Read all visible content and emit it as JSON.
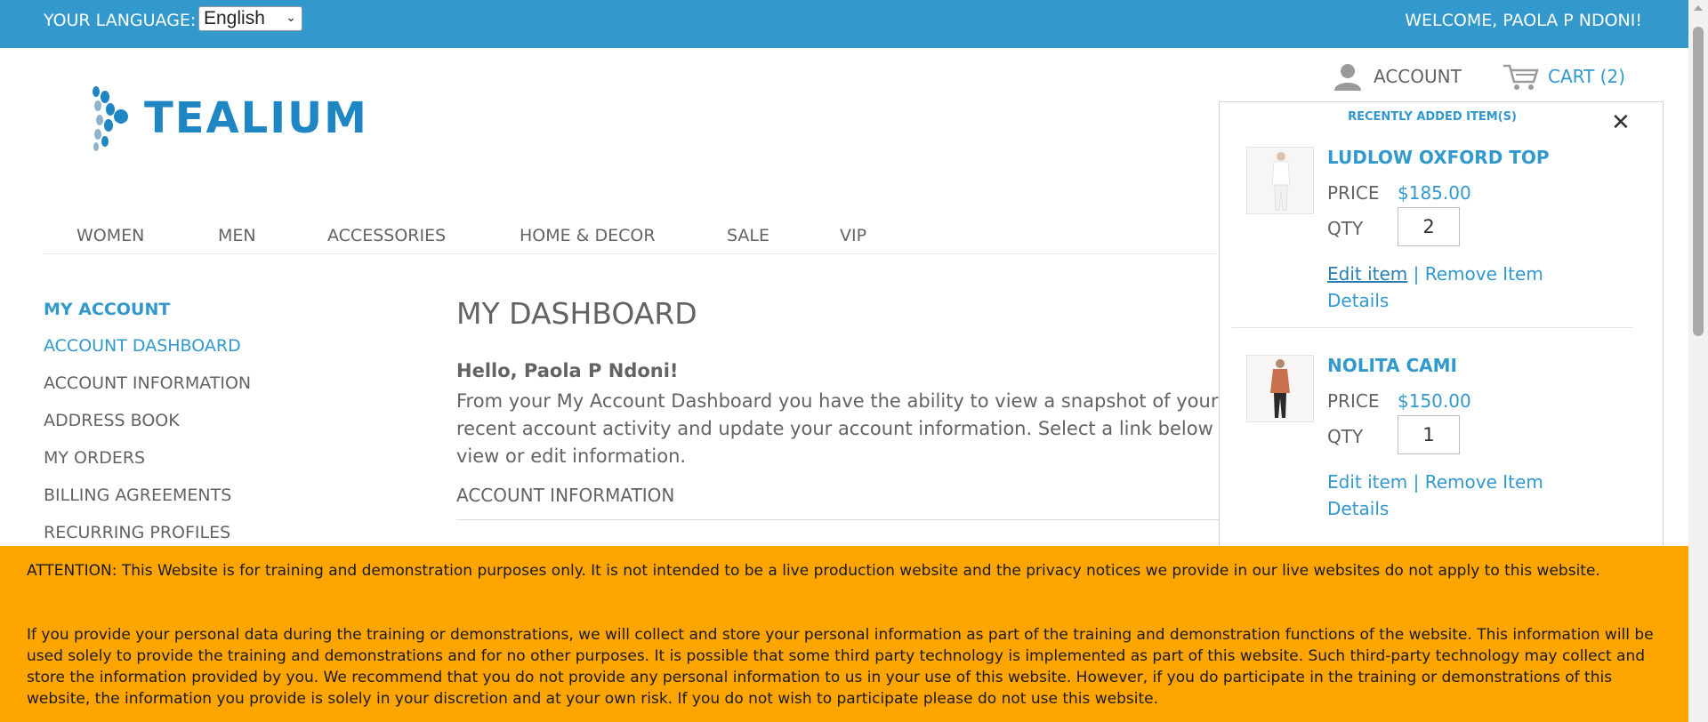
{
  "topbar": {
    "language_label": "YOUR LANGUAGE:",
    "language_selected": "English",
    "welcome": "WELCOME, PAOLA P NDONI!",
    "background_color": "#3399cc"
  },
  "header": {
    "logo_text": "TEALIUM",
    "account_label": "ACCOUNT",
    "cart_label": "CART (2)",
    "account_icon": "user-icon",
    "cart_icon": "cart-icon"
  },
  "nav": {
    "items": [
      "WOMEN",
      "MEN",
      "ACCESSORIES",
      "HOME & DECOR",
      "SALE",
      "VIP"
    ]
  },
  "sidebar": {
    "title": "MY ACCOUNT",
    "items": [
      "ACCOUNT DASHBOARD",
      "ACCOUNT INFORMATION",
      "ADDRESS BOOK",
      "MY ORDERS",
      "BILLING AGREEMENTS",
      "RECURRING PROFILES"
    ],
    "active_index": 0
  },
  "main": {
    "title": "MY DASHBOARD",
    "hello": "Hello, Paola P Ndoni!",
    "intro": "From your My Account Dashboard you have the ability to view a snapshot of your recent account activity and update your account information. Select a link below to view or edit information.",
    "section_title": "ACCOUNT INFORMATION"
  },
  "cart_panel": {
    "heading": "RECENTLY ADDED ITEM(S)",
    "close_icon": "close-icon",
    "price_label": "PRICE",
    "qty_label": "QTY",
    "edit_label": "Edit item",
    "separator": "|",
    "remove_label": "Remove Item",
    "details_label": "Details",
    "items": [
      {
        "name": "LUDLOW OXFORD TOP",
        "price": "$185.00",
        "qty": "2"
      },
      {
        "name": "NOLITA CAMI",
        "price": "$150.00",
        "qty": "1"
      }
    ]
  },
  "notice": {
    "paragraph1": "ATTENTION: This Website is for training and demonstration purposes only. It is not intended to be a live production website and the privacy notices we provide in our live websites do not apply to this website.",
    "paragraph2": "If you provide your personal data during the training or demonstrations, we will collect and store your personal information as part of the training and demonstration functions of the website. This information will be used solely to provide the training and demonstrations and for no other purposes. It is possible that some third party technology is implemented as part of this website. Such third-party technology may collect and store the information provided by you. We recommend that you do not provide any personal information to us in your use of this website. However, if you do participate in the training or demonstrations of this website, the information you provide is solely in your discretion and at your own risk. If you do not wish to participate please do not use this website.",
    "background_color": "#ffa500"
  }
}
